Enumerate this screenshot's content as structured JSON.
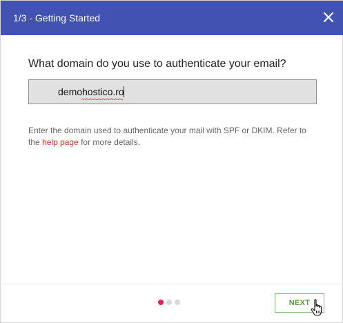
{
  "header": {
    "title": "1/3 - Getting Started",
    "close_icon": "close-icon"
  },
  "main": {
    "question": "What domain do you use to authenticate your email?",
    "domain_value": "demohostico.ro",
    "help_text_before": "Enter the domain used to authenticate your mail with SPF or DKIM. Refer to the ",
    "help_link": "help page",
    "help_text_after": " for more details."
  },
  "footer": {
    "steps_total": 3,
    "step_current": 1,
    "next_label": "NEXT"
  },
  "colors": {
    "header_bg": "#4152b3",
    "active_dot": "#e91e63",
    "link": "#c0392b",
    "next_text": "#5a9a47"
  }
}
